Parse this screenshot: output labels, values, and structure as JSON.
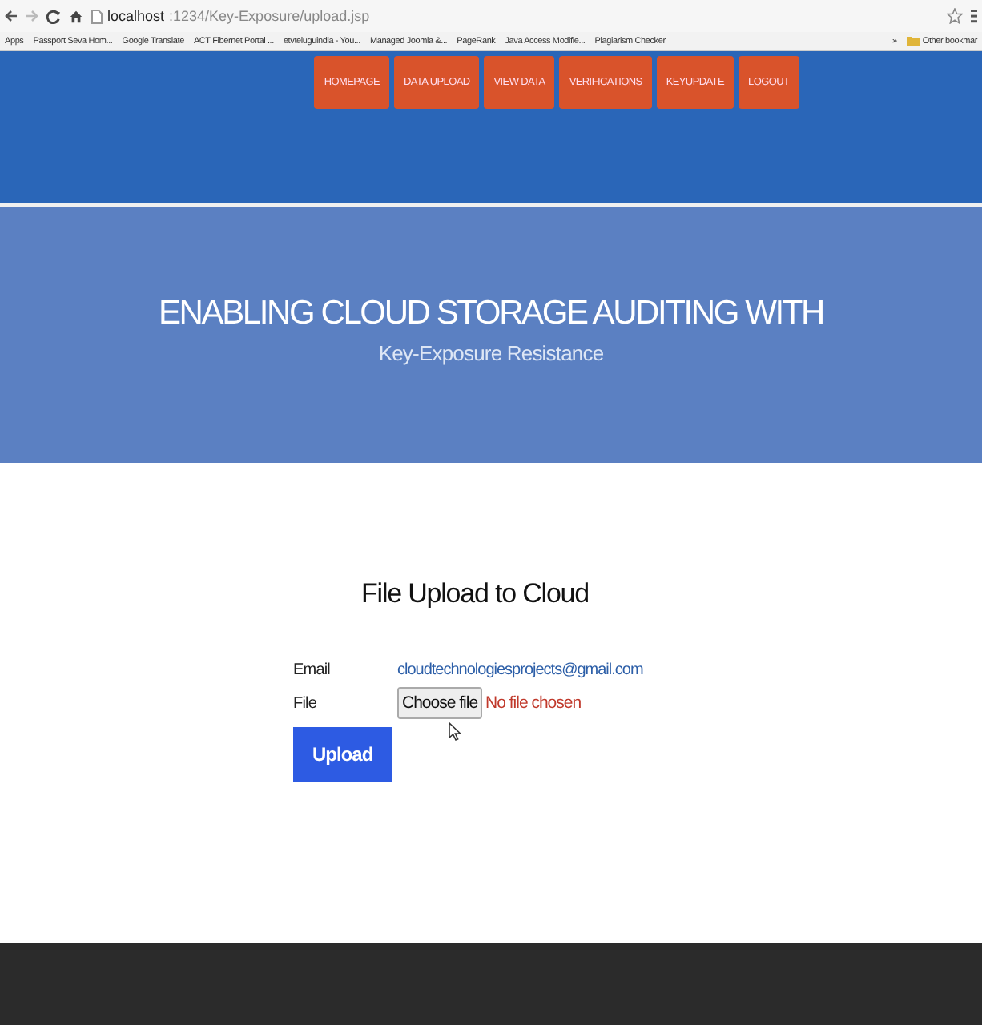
{
  "browser": {
    "url_host": "localhost",
    "url_path": ":1234/Key-Exposure/upload.jsp"
  },
  "bookmarks": [
    {
      "label": "Apps"
    },
    {
      "label": "Passport Seva Hom..."
    },
    {
      "label": "Google Translate"
    },
    {
      "label": "ACT Fibernet Portal ..."
    },
    {
      "label": "etvteluguindia - You..."
    },
    {
      "label": "Managed Joomla &..."
    },
    {
      "label": "PageRank"
    },
    {
      "label": "Java Access Modifie..."
    },
    {
      "label": "Plagiarism Checker"
    }
  ],
  "bookmarks_more": "»",
  "other_bookmarks": "Other bookmar",
  "nav": [
    {
      "label": "HOMEPAGE"
    },
    {
      "label": "DATA UPLOAD"
    },
    {
      "label": "VIEW DATA"
    },
    {
      "label": "VERIFICATIONS"
    },
    {
      "label": "KEYUPDATE"
    },
    {
      "label": "LOGOUT"
    }
  ],
  "hero": {
    "title": "ENABLING CLOUD STORAGE AUDITING WITH",
    "subtitle": "Key-Exposure Resistance"
  },
  "form": {
    "heading": "File Upload to Cloud",
    "email_label": "Email",
    "email_value": "cloudtechnologiesprojects@gmail.com",
    "file_label": "File",
    "choose_button": "Choose file",
    "file_status": "No file chosen",
    "submit": "Upload"
  }
}
